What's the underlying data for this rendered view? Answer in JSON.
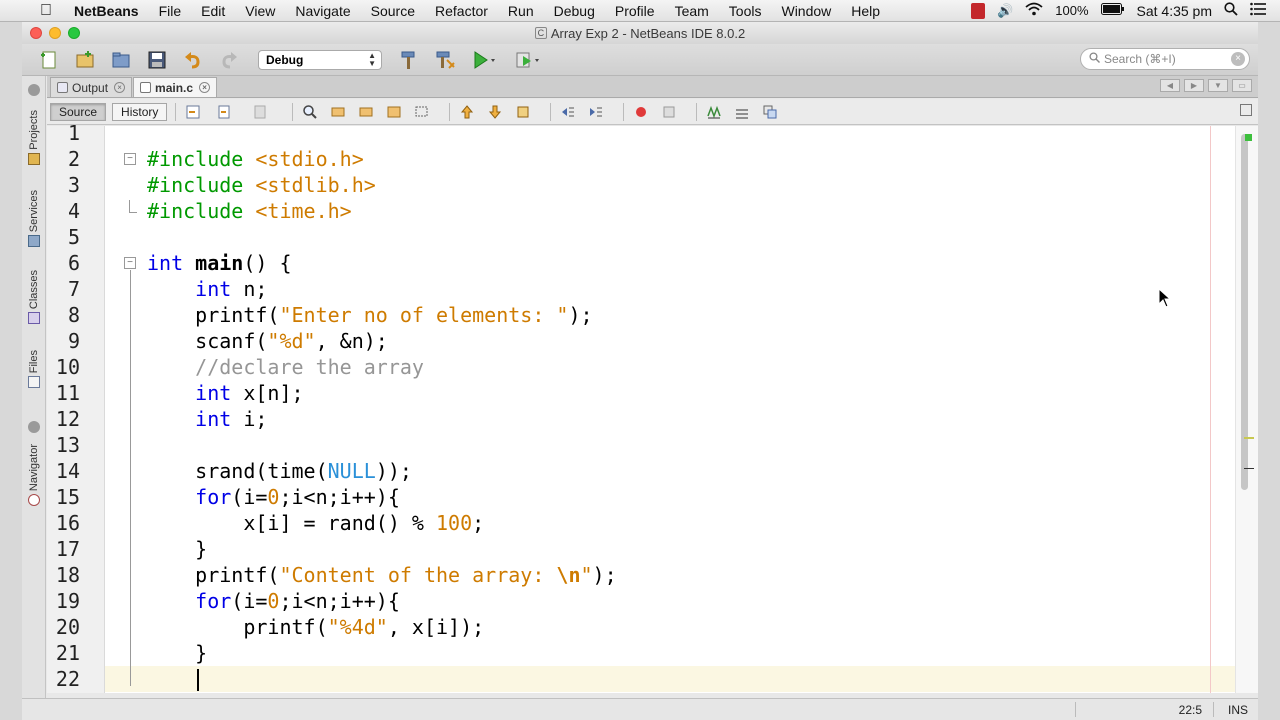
{
  "menubar": {
    "app_name": "NetBeans",
    "items": [
      "File",
      "Edit",
      "View",
      "Navigate",
      "Source",
      "Refactor",
      "Run",
      "Debug",
      "Profile",
      "Team",
      "Tools",
      "Window",
      "Help"
    ],
    "battery": "100%",
    "clock": "Sat 4:35 pm"
  },
  "window": {
    "title": "Array Exp 2 - NetBeans IDE 8.0.2"
  },
  "toolbar": {
    "config_value": "Debug",
    "search_placeholder": "Search (⌘+I)"
  },
  "sidebar": {
    "tabs": [
      "Projects",
      "Services",
      "Classes",
      "Files",
      "Navigator"
    ]
  },
  "tabs": [
    {
      "label": "Output"
    },
    {
      "label": "main.c"
    }
  ],
  "editor_toolbar": {
    "source_label": "Source",
    "history_label": "History"
  },
  "code": {
    "lines": [
      {
        "n": "1",
        "html": ""
      },
      {
        "n": "2",
        "html": "<span class='pp'>#include</span> <span class='str'>&lt;stdio.h&gt;</span>"
      },
      {
        "n": "3",
        "html": "<span class='pp'>#include</span> <span class='str'>&lt;stdlib.h&gt;</span>"
      },
      {
        "n": "4",
        "html": "<span class='pp'>#include</span> <span class='str'>&lt;time.h&gt;</span>"
      },
      {
        "n": "5",
        "html": ""
      },
      {
        "n": "6",
        "html": "<span class='kw'>int</span> <span class='bold'>main</span>() {"
      },
      {
        "n": "7",
        "html": "    <span class='kw'>int</span> n;"
      },
      {
        "n": "8",
        "html": "    printf(<span class='str'>\"Enter no of elements: \"</span>);"
      },
      {
        "n": "9",
        "html": "    scanf(<span class='str'>\"%d\"</span>, &amp;n);"
      },
      {
        "n": "10",
        "html": "    <span class='cmt'>//declare the array</span>"
      },
      {
        "n": "11",
        "html": "    <span class='kw'>int</span> x[n];"
      },
      {
        "n": "12",
        "html": "    <span class='kw'>int</span> i;"
      },
      {
        "n": "13",
        "html": ""
      },
      {
        "n": "14",
        "html": "    srand(time(<span class='nul'>NULL</span>));"
      },
      {
        "n": "15",
        "html": "    <span class='kw'>for</span>(i=<span class='num'>0</span>;i&lt;n;i++){"
      },
      {
        "n": "16",
        "html": "        x[i] = rand() % <span class='num'>100</span>;"
      },
      {
        "n": "17",
        "html": "    }"
      },
      {
        "n": "18",
        "html": "    printf(<span class='str'>\"Content of the array: </span><span class='esc'>\\n</span><span class='str'>\"</span>);"
      },
      {
        "n": "19",
        "html": "    <span class='kw'>for</span>(i=<span class='num'>0</span>;i&lt;n;i++){"
      },
      {
        "n": "20",
        "html": "        printf(<span class='str'>\"%4d\"</span>, x[i]);"
      },
      {
        "n": "21",
        "html": "    }"
      },
      {
        "n": "22",
        "html": ""
      }
    ]
  },
  "statusbar": {
    "position": "22:5",
    "mode": "INS"
  }
}
